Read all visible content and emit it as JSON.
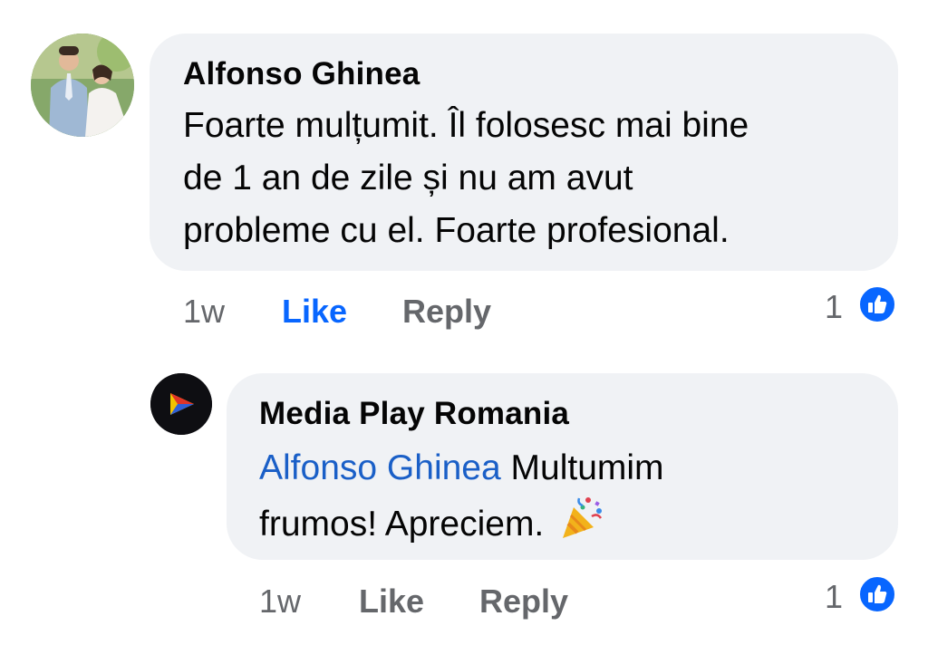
{
  "comment": {
    "author": "Alfonso Ghinea",
    "lines": [
      "Foarte mulțumit. Îl folosesc mai bine",
      "de 1 an de zile și nu am avut",
      "probleme cu el. Foarte profesional."
    ],
    "time": "1w",
    "like_label": "Like",
    "reply_label": "Reply",
    "reaction_count": "1"
  },
  "reply": {
    "author": "Media Play Romania",
    "mention": "Alfonso Ghinea",
    "line1_rest": " Multumim",
    "line2": "frumos! Apreciem.",
    "emoji": "🎉",
    "time": "1w",
    "like_label": "Like",
    "reply_label": "Reply",
    "reaction_count": "1"
  },
  "colors": {
    "bubble": "#f0f2f5",
    "like_active": "#0866ff",
    "meta": "#65676b",
    "mention": "#1a5fc7"
  },
  "icons": {
    "reaction": "like-thumb-icon",
    "celebration": "party-popper-icon"
  }
}
